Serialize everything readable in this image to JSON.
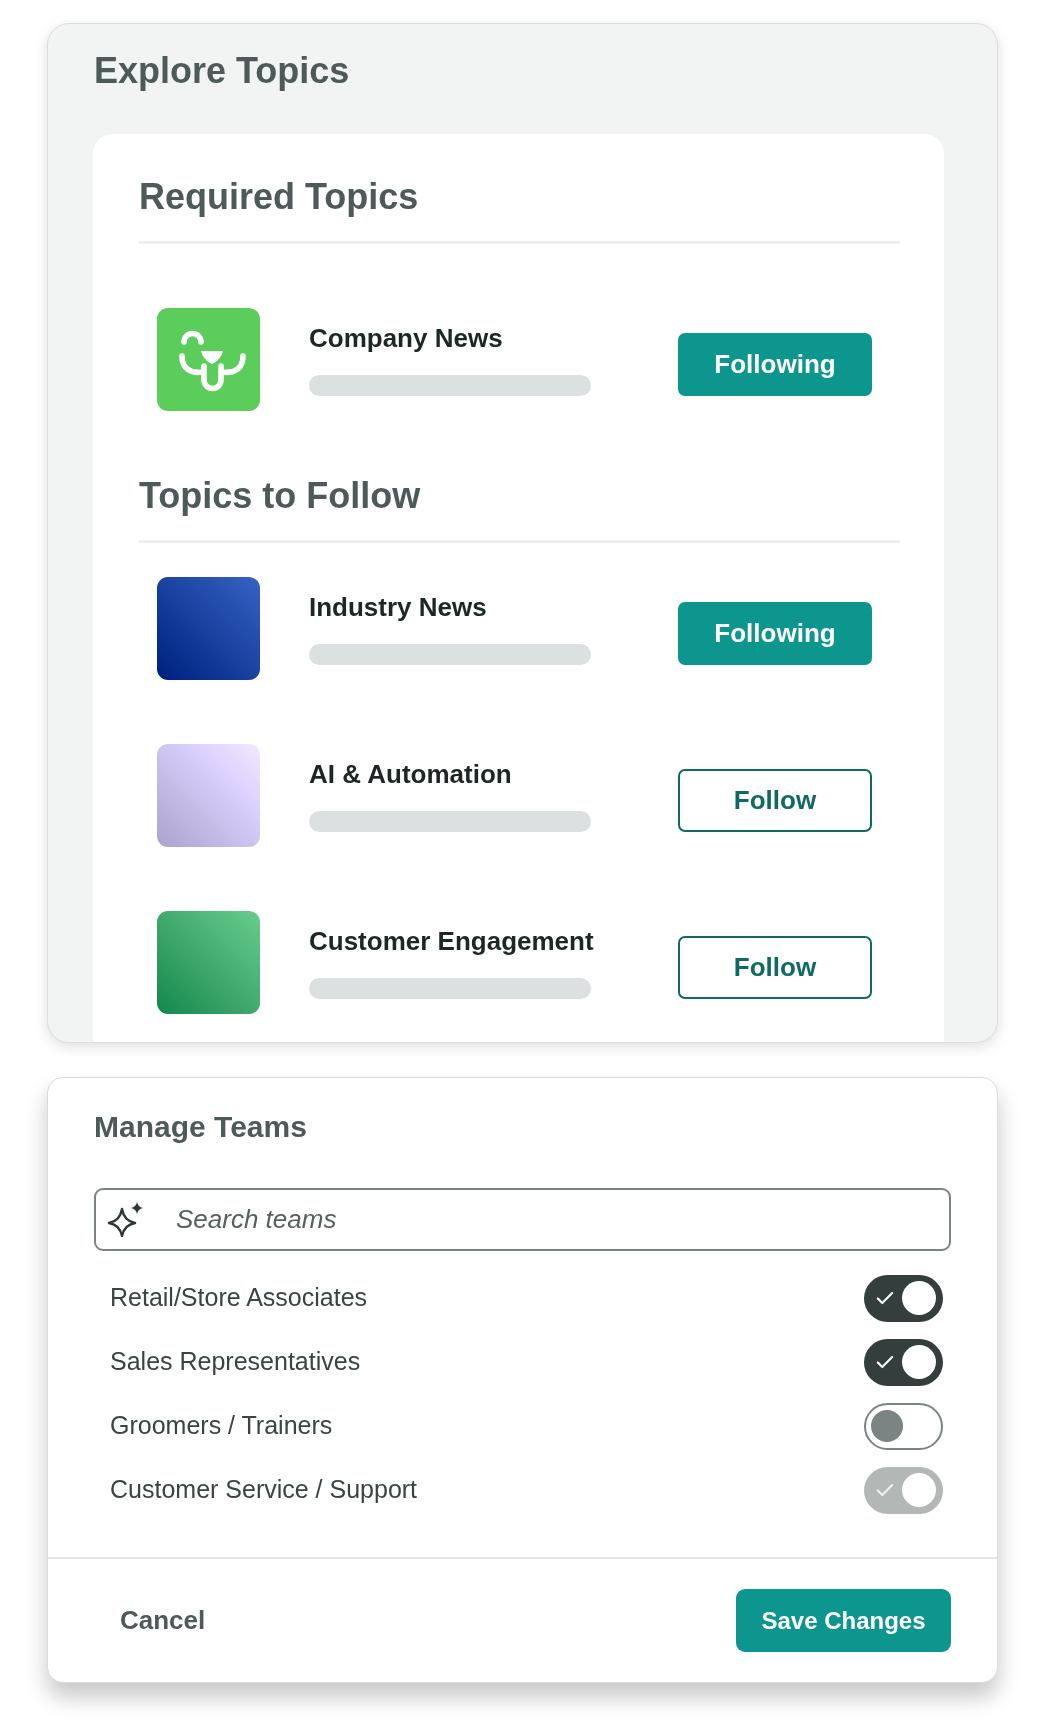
{
  "explore_topics": {
    "title": "Explore Topics",
    "sections": [
      {
        "title": "Required Topics",
        "topics": [
          {
            "name": "Company News",
            "icon": {
              "kind": "logo",
              "color": "#5bcd5a"
            },
            "button_label": "Following",
            "following": true
          }
        ]
      },
      {
        "title": "Topics to Follow",
        "topics": [
          {
            "name": "Industry News",
            "icon": {
              "kind": "tile",
              "color": "#1c45a4"
            },
            "button_label": "Following",
            "following": true
          },
          {
            "name": "AI & Automation",
            "icon": {
              "kind": "tile",
              "color": "#d2c8f5"
            },
            "button_label": "Follow",
            "following": false
          },
          {
            "name": "Customer Engagement",
            "icon": {
              "kind": "tile",
              "color": "#44ad70"
            },
            "button_label": "Follow",
            "following": false
          }
        ]
      }
    ]
  },
  "manage_teams": {
    "title": "Manage Teams",
    "search": {
      "placeholder": "Search teams"
    },
    "teams": [
      {
        "label": "Retail/Store Associates",
        "on": true,
        "disabled": false
      },
      {
        "label": "Sales Representatives",
        "on": true,
        "disabled": false
      },
      {
        "label": "Groomers / Trainers",
        "on": false,
        "disabled": false
      },
      {
        "label": "Customer Service / Support",
        "on": true,
        "disabled": true
      }
    ],
    "buttons": [
      {
        "label": "Cancel",
        "kind": "secondary"
      },
      {
        "label": "Save Changes",
        "kind": "primary"
      }
    ]
  }
}
